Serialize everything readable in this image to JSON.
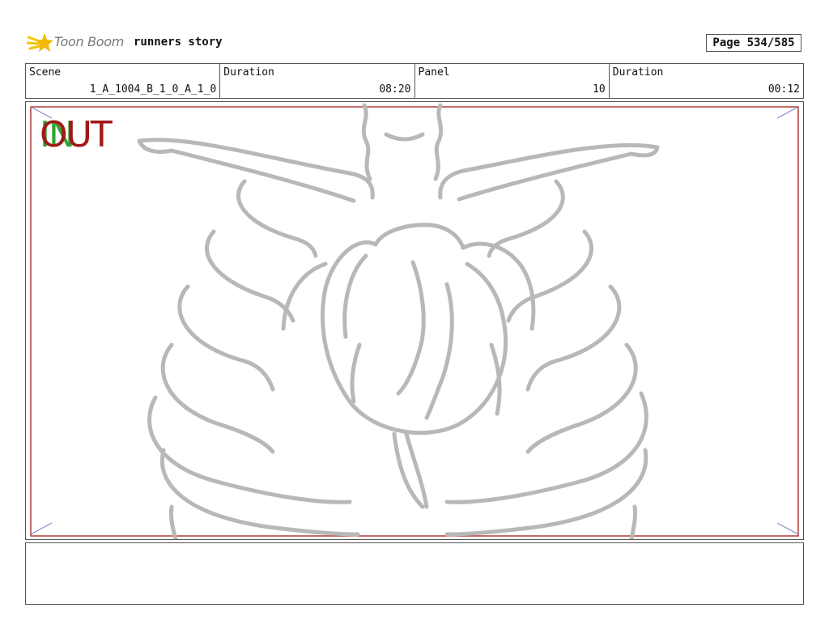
{
  "header": {
    "logo_text": "Toon Boom",
    "project_name": "runners story",
    "page": "Page 534/585"
  },
  "info": {
    "scene_label": "Scene",
    "scene_value": "1_A_1004_B_1_0_A_1_0",
    "scene_duration_label": "Duration",
    "scene_duration_value": "08:20",
    "panel_label": "Panel",
    "panel_value": "10",
    "panel_duration_label": "Duration",
    "panel_duration_value": "00:12"
  },
  "panel": {
    "in_mark": "IN",
    "out_mark": "OUT",
    "colors": {
      "in": "#2fa32f",
      "out": "#a01818",
      "safe_frame": "#b03a3a",
      "sketch": "#b8b8b8",
      "corner_marks": "#8a8ac8"
    }
  },
  "notes": {
    "text": ""
  }
}
